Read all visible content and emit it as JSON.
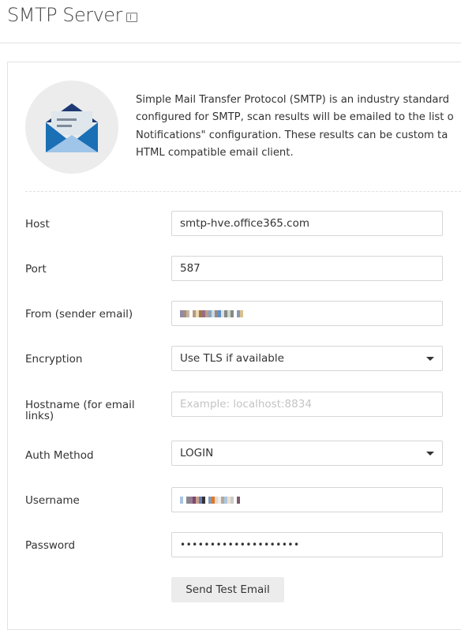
{
  "header": {
    "title": "SMTP Server",
    "icon": "book-icon"
  },
  "intro": {
    "icon": "envelope-open-icon",
    "lines": [
      "Simple Mail Transfer Protocol (SMTP) is an industry standard",
      "configured for SMTP, scan results will be emailed to the list o",
      "Notifications\" configuration. These results can be custom ta",
      "HTML compatible email client."
    ]
  },
  "form": {
    "host": {
      "label": "Host",
      "value": "smtp-hve.office365.com"
    },
    "port": {
      "label": "Port",
      "value": "587"
    },
    "from": {
      "label": "From (sender email)"
    },
    "encryption": {
      "label": "Encryption",
      "value": "Use TLS if available"
    },
    "hostname": {
      "label": "Hostname (for email links)",
      "placeholder": "Example: localhost:8834"
    },
    "auth": {
      "label": "Auth Method",
      "value": "LOGIN"
    },
    "username": {
      "label": "Username"
    },
    "password": {
      "label": "Password",
      "value": "••••••••••••••••••••"
    }
  },
  "actions": {
    "send_test": "Send Test Email"
  }
}
